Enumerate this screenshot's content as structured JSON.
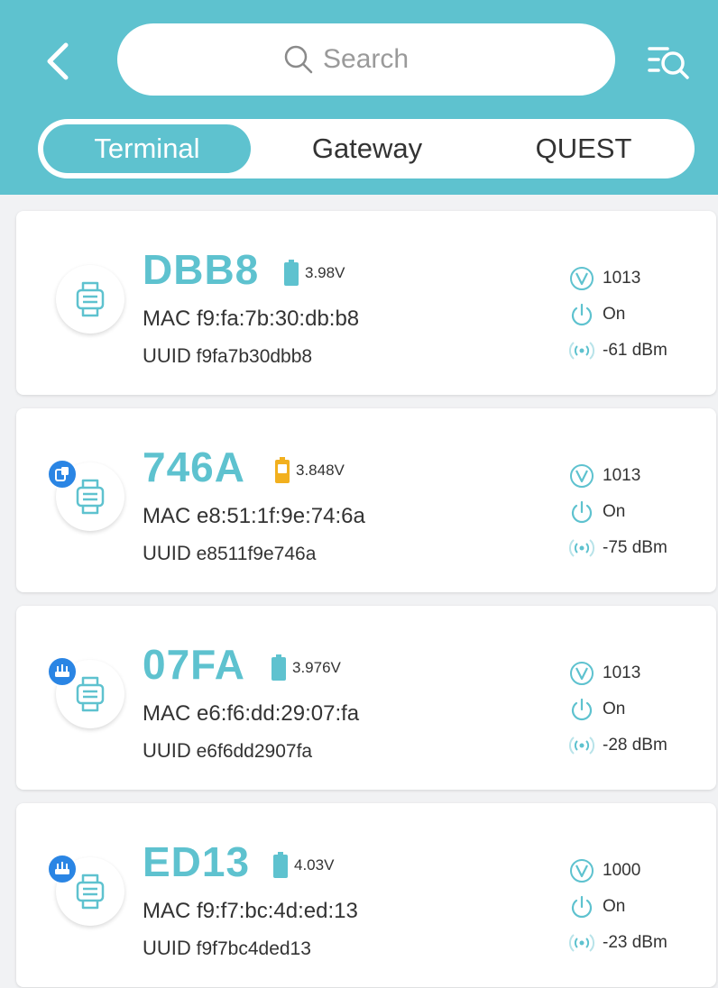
{
  "header": {
    "search_placeholder": "Search"
  },
  "tabs": [
    {
      "label": "Terminal",
      "active": true
    },
    {
      "label": "Gateway",
      "active": false
    },
    {
      "label": "QUEST",
      "active": false
    }
  ],
  "colors": {
    "accent": "#5ec2cf",
    "battery_ok": "#5ec2cf",
    "battery_warn": "#f2b01e",
    "badge": "#2a85e4"
  },
  "devices": [
    {
      "name": "DBB8",
      "battery": "3.98V",
      "battery_status": "ok",
      "mac": "MAC f9:fa:7b:30:db:b8",
      "uuid_label": "UUID",
      "uuid": "f9fa7b30dbb8",
      "version": "1013",
      "power": "On",
      "rssi": "-61 dBm",
      "badge": null
    },
    {
      "name": "746A",
      "battery": "3.848V",
      "battery_status": "warn",
      "mac": "MAC e8:51:1f:9e:74:6a",
      "uuid_label": "UUID",
      "uuid": "e8511f9e746a",
      "version": "1013",
      "power": "On",
      "rssi": "-75 dBm",
      "badge": "device-badge-icon"
    },
    {
      "name": "07FA",
      "battery": "3.976V",
      "battery_status": "ok",
      "mac": "MAC e6:f6:dd:29:07:fa",
      "uuid_label": "UUID",
      "uuid": "e6f6dd2907fa",
      "version": "1013",
      "power": "On",
      "rssi": "-28 dBm",
      "badge": "gateway-badge-icon"
    },
    {
      "name": "ED13",
      "battery": "4.03V",
      "battery_status": "ok",
      "mac": "MAC f9:f7:bc:4d:ed:13",
      "uuid_label": "UUID",
      "uuid": "f9f7bc4ded13",
      "version": "1000",
      "power": "On",
      "rssi": "-23 dBm",
      "badge": "gateway-badge-icon"
    }
  ]
}
